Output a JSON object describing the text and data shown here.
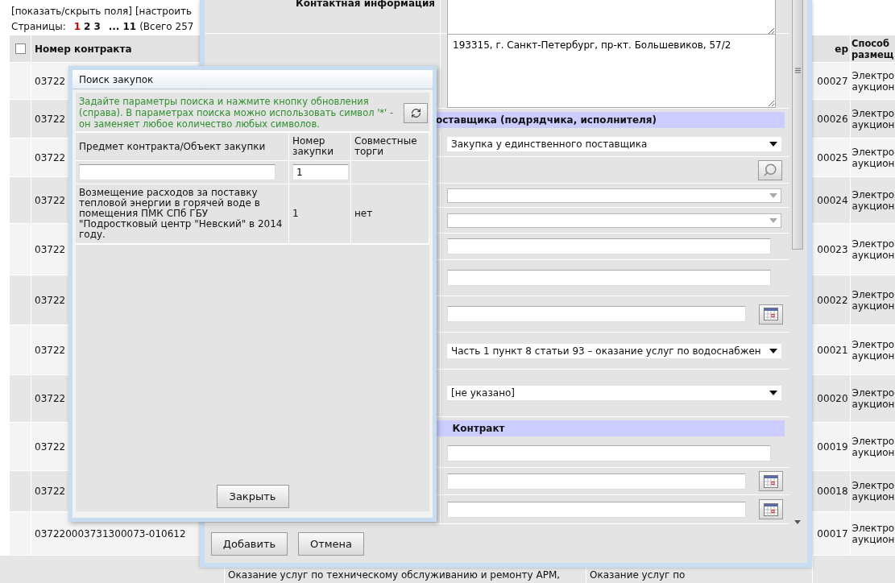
{
  "list_page": {
    "links": [
      "[показать/скрыть поля]",
      "[настроить"
    ],
    "pagination": {
      "label": "Страницы:",
      "pages": [
        {
          "label": "1",
          "selected": true
        },
        {
          "label": "2",
          "selected": false
        },
        {
          "label": "3",
          "selected": false
        },
        {
          "label": "...",
          "selected": false
        },
        {
          "label": "11",
          "selected": false
        }
      ],
      "total": "(Всего 257"
    },
    "table": {
      "select_all": {
        "checked": false
      },
      "columns": [
        "Номер контракта",
        "ер",
        "Способ размещ"
      ],
      "rows": [
        {
          "number": "03722",
          "number_end": "00027",
          "method": "Электро аукцион"
        },
        {
          "number": "03722",
          "number_end": "00026",
          "method": "Электро аукцион"
        },
        {
          "number": "03722",
          "number_end": "00025",
          "method": "Электро аукцион"
        },
        {
          "number": "03722",
          "number_end": "00024",
          "method": "Электро аукцион"
        },
        {
          "number": "03722",
          "number_end": "00023",
          "method": "Электро аукцион"
        },
        {
          "number": "03722",
          "number_end": "00022",
          "method": "Электро аукцион"
        },
        {
          "number": "03722",
          "number_end": "00021",
          "method": "Электро аукцион"
        },
        {
          "number": "03722",
          "number_end": "00020",
          "method": "Электро аукцион"
        },
        {
          "number": "03722",
          "number_end": "00019",
          "method": "Электро аукцион"
        },
        {
          "number": "03722",
          "number_end": "00018",
          "method": "Электро аукцион"
        },
        {
          "number": "037220003731300073-010612",
          "number_end": "00017",
          "method": "Электро аукцион"
        }
      ]
    },
    "bottom_row": [
      "Оказание услуг по техническому обслуживанию и ремонту АРМ,",
      "Оказание услуг по"
    ]
  },
  "form_window": {
    "rows": [
      {
        "kind": "textarea",
        "label": "Контактная информация"
      },
      {
        "kind": "textarea",
        "value": "193315, г. Санкт-Петербург, пр-кт. Большевиков, 57/2"
      },
      {
        "kind": "section",
        "title": "оставщика (подрядчика, исполнителя)"
      },
      {
        "kind": "select",
        "value": "Закупка у единственного поставщика",
        "disabled": false
      },
      {
        "kind": "search"
      },
      {
        "kind": "select",
        "disabled": true
      },
      {
        "kind": "select",
        "disabled": true
      },
      {
        "kind": "input"
      },
      {
        "kind": "input"
      },
      {
        "kind": "date"
      },
      {
        "kind": "select",
        "value": "Часть 1 пункт 8 статьи 93 – оказание услуг по водоснабжен",
        "disabled": false
      },
      {
        "kind": "select",
        "value": "[не указано]",
        "disabled": false
      },
      {
        "kind": "section_centered",
        "title": "Контракт"
      },
      {
        "kind": "input"
      },
      {
        "kind": "date"
      },
      {
        "kind": "date"
      }
    ],
    "buttons": [
      "Добавить",
      "Отмена"
    ]
  },
  "search_dialog": {
    "title": "Поиск закупок",
    "hint": "Задайте параметры поиска и нажмите кнопку обновления (справа). В параметрах поиска можно использовать символ '*' - он заменяет любое количество любых символов.",
    "columns": [
      "Предмет контракта/Объект закупки",
      "Номер закупки",
      "Совместные торги"
    ],
    "filter_number": "1",
    "rows": [
      {
        "subject": "Возмещение расходов за поставку тепловой энергии в горячей воде в помещения ПМК СПб ГБУ \"Подростковый центр \"Невский\" в 2014 году.",
        "number": "1",
        "joint": "нет"
      }
    ],
    "close_button": "Закрыть"
  }
}
